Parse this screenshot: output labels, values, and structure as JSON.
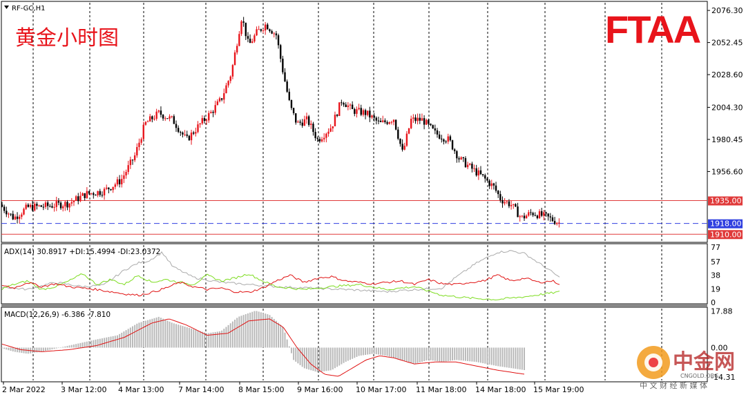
{
  "chart_data": {
    "type": "candlestick",
    "symbol": "RF-GC,H1",
    "title": "黄金小时图",
    "logo": "FTAA",
    "watermark": {
      "name": "中金网",
      "domain": "CNGOLD.ORG",
      "tagline": "中 文 财 经 新 媒 体"
    },
    "price_axis": {
      "ticks": [
        2076.3,
        2052.45,
        2028.6,
        2004.3,
        1980.45,
        1956.6
      ],
      "ylim": [
        1905.0,
        2082.0
      ]
    },
    "horizontal_levels": [
      {
        "label": "1935.00",
        "value": 1935.0,
        "color": "#e03a3a",
        "style": "solid"
      },
      {
        "label": "1918.00",
        "value": 1918.0,
        "color": "#2f3fe0",
        "style": "dashed"
      },
      {
        "label": "1910.00",
        "value": 1910.0,
        "color": "#e03a3a",
        "style": "solid"
      }
    ],
    "x_axis": {
      "labels": [
        "2 Mar 2022",
        "3 Mar 12:00",
        "4 Mar 13:00",
        "7 Mar 14:00",
        "8 Mar 15:00",
        "9 Mar 16:00",
        "10 Mar 17:00",
        "11 Mar 18:00",
        "14 Mar 18:00",
        "15 Mar 19:00"
      ]
    },
    "price_path": [
      [
        0,
        1932
      ],
      [
        20,
        1922
      ],
      [
        40,
        1930
      ],
      [
        70,
        1931
      ],
      [
        100,
        1933
      ],
      [
        125,
        1940
      ],
      [
        150,
        1942
      ],
      [
        175,
        1950
      ],
      [
        195,
        1968
      ],
      [
        210,
        1992
      ],
      [
        230,
        2000
      ],
      [
        250,
        1995
      ],
      [
        270,
        1980
      ],
      [
        290,
        1992
      ],
      [
        305,
        2000
      ],
      [
        320,
        2010
      ],
      [
        335,
        2030
      ],
      [
        350,
        2072
      ],
      [
        360,
        2050
      ],
      [
        372,
        2060
      ],
      [
        385,
        2066
      ],
      [
        400,
        2058
      ],
      [
        410,
        2030
      ],
      [
        420,
        2005
      ],
      [
        430,
        1992
      ],
      [
        445,
        1995
      ],
      [
        460,
        1980
      ],
      [
        480,
        1990
      ],
      [
        495,
        2010
      ],
      [
        510,
        2002
      ],
      [
        530,
        2000
      ],
      [
        550,
        1992
      ],
      [
        570,
        1996
      ],
      [
        583,
        1970
      ],
      [
        595,
        1995
      ],
      [
        612,
        1995
      ],
      [
        630,
        1985
      ],
      [
        650,
        1980
      ],
      [
        665,
        1966
      ],
      [
        685,
        1958
      ],
      [
        700,
        1952
      ],
      [
        715,
        1945
      ],
      [
        725,
        1936
      ],
      [
        740,
        1932
      ],
      [
        755,
        1922
      ],
      [
        770,
        1926
      ],
      [
        790,
        1923
      ],
      [
        812,
        1918
      ]
    ],
    "adx": {
      "label": "ADX(14) 30.8917 +DI:15.4994 -DI:23.0372",
      "adx": 30.8917,
      "plus_di": 15.4994,
      "minus_di": 23.0372,
      "ticks": [
        77,
        57,
        38,
        19,
        0
      ],
      "ylim": [
        0,
        80
      ],
      "adx_path": [
        [
          0,
          22
        ],
        [
          40,
          18
        ],
        [
          80,
          28
        ],
        [
          120,
          22
        ],
        [
          150,
          24
        ],
        [
          180,
          45
        ],
        [
          200,
          55
        ],
        [
          215,
          58
        ],
        [
          235,
          70
        ],
        [
          250,
          50
        ],
        [
          280,
          35
        ],
        [
          320,
          28
        ],
        [
          360,
          25
        ],
        [
          400,
          22
        ],
        [
          450,
          20
        ],
        [
          500,
          18
        ],
        [
          560,
          15
        ],
        [
          600,
          18
        ],
        [
          640,
          20
        ],
        [
          660,
          35
        ],
        [
          690,
          55
        ],
        [
          720,
          70
        ],
        [
          740,
          72
        ],
        [
          760,
          68
        ],
        [
          780,
          55
        ],
        [
          800,
          42
        ],
        [
          812,
          33
        ]
      ],
      "plus_path": [
        [
          0,
          18
        ],
        [
          20,
          25
        ],
        [
          40,
          30
        ],
        [
          60,
          18
        ],
        [
          80,
          22
        ],
        [
          100,
          30
        ],
        [
          120,
          40
        ],
        [
          140,
          25
        ],
        [
          160,
          32
        ],
        [
          180,
          25
        ],
        [
          200,
          38
        ],
        [
          220,
          28
        ],
        [
          240,
          32
        ],
        [
          260,
          28
        ],
        [
          280,
          25
        ],
        [
          300,
          38
        ],
        [
          320,
          30
        ],
        [
          340,
          34
        ],
        [
          360,
          40
        ],
        [
          380,
          30
        ],
        [
          400,
          22
        ],
        [
          440,
          18
        ],
        [
          480,
          22
        ],
        [
          520,
          25
        ],
        [
          560,
          18
        ],
        [
          600,
          22
        ],
        [
          640,
          10
        ],
        [
          680,
          6
        ],
        [
          720,
          4
        ],
        [
          760,
          8
        ],
        [
          790,
          12
        ],
        [
          812,
          15
        ]
      ],
      "minus_path": [
        [
          0,
          25
        ],
        [
          20,
          20
        ],
        [
          40,
          28
        ],
        [
          60,
          22
        ],
        [
          80,
          26
        ],
        [
          100,
          22
        ],
        [
          120,
          20
        ],
        [
          140,
          18
        ],
        [
          160,
          15
        ],
        [
          180,
          12
        ],
        [
          200,
          10
        ],
        [
          220,
          14
        ],
        [
          240,
          20
        ],
        [
          260,
          28
        ],
        [
          280,
          22
        ],
        [
          300,
          18
        ],
        [
          320,
          20
        ],
        [
          340,
          15
        ],
        [
          360,
          14
        ],
        [
          380,
          20
        ],
        [
          400,
          30
        ],
        [
          420,
          38
        ],
        [
          440,
          28
        ],
        [
          460,
          34
        ],
        [
          480,
          36
        ],
        [
          500,
          30
        ],
        [
          520,
          28
        ],
        [
          540,
          26
        ],
        [
          560,
          28
        ],
        [
          580,
          30
        ],
        [
          600,
          25
        ],
        [
          620,
          32
        ],
        [
          640,
          26
        ],
        [
          660,
          25
        ],
        [
          680,
          28
        ],
        [
          700,
          30
        ],
        [
          720,
          38
        ],
        [
          740,
          30
        ],
        [
          760,
          34
        ],
        [
          780,
          28
        ],
        [
          800,
          30
        ],
        [
          812,
          25
        ]
      ]
    },
    "macd": {
      "label": "MACD(12,26,9) -6.386 -7.810",
      "main": -6.386,
      "signal": -7.81,
      "ticks": [
        17.88,
        0.0,
        -14.31
      ],
      "ylim": [
        -16,
        19
      ],
      "signal_path": [
        [
          0,
          2
        ],
        [
          30,
          -1
        ],
        [
          60,
          -2
        ],
        [
          100,
          -1
        ],
        [
          140,
          1
        ],
        [
          180,
          5
        ],
        [
          220,
          12
        ],
        [
          245,
          14
        ],
        [
          270,
          11
        ],
        [
          300,
          6
        ],
        [
          330,
          7
        ],
        [
          360,
          13
        ],
        [
          390,
          14
        ],
        [
          410,
          10
        ],
        [
          430,
          0
        ],
        [
          450,
          -8
        ],
        [
          470,
          -13
        ],
        [
          490,
          -14
        ],
        [
          510,
          -10
        ],
        [
          530,
          -6
        ],
        [
          550,
          -4
        ],
        [
          570,
          -5
        ],
        [
          600,
          -8
        ],
        [
          630,
          -7
        ],
        [
          660,
          -7
        ],
        [
          690,
          -9
        ],
        [
          720,
          -11
        ],
        [
          740,
          -12
        ],
        [
          760,
          -13
        ]
      ],
      "hist_path": [
        [
          0,
          0
        ],
        [
          20,
          -2
        ],
        [
          40,
          -3
        ],
        [
          60,
          -2
        ],
        [
          100,
          1
        ],
        [
          140,
          4
        ],
        [
          170,
          6
        ],
        [
          200,
          12
        ],
        [
          230,
          15
        ],
        [
          250,
          12
        ],
        [
          280,
          9
        ],
        [
          300,
          7
        ],
        [
          320,
          8
        ],
        [
          345,
          15
        ],
        [
          370,
          18
        ],
        [
          390,
          16
        ],
        [
          410,
          10
        ],
        [
          425,
          -6
        ],
        [
          440,
          -10
        ],
        [
          460,
          -12
        ],
        [
          480,
          -11
        ],
        [
          500,
          -7
        ],
        [
          520,
          -4
        ],
        [
          540,
          -3
        ],
        [
          560,
          -4
        ],
        [
          580,
          -6
        ],
        [
          600,
          -8
        ],
        [
          620,
          -6
        ],
        [
          640,
          -7
        ],
        [
          660,
          -6
        ],
        [
          690,
          -7
        ],
        [
          720,
          -9
        ],
        [
          740,
          -10
        ],
        [
          760,
          -11
        ]
      ]
    }
  },
  "colors": {
    "bull": "#e8141b",
    "bear": "#000000",
    "grid": "#000000",
    "adx_line": "#aaaaaa",
    "plus_di": "#7ddc1f",
    "minus_di": "#e01010",
    "macd_hist": "#b9b9b9",
    "macd_signal": "#e01010",
    "logo": "#e8141b"
  }
}
